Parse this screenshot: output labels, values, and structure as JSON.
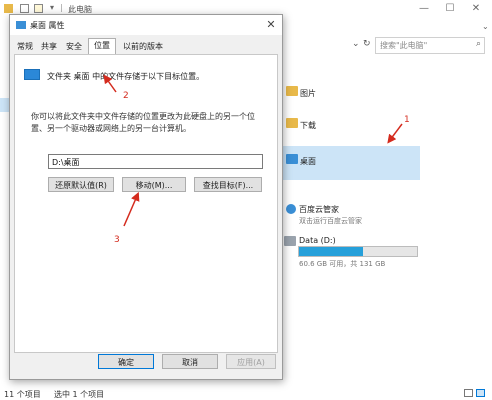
{
  "explorer": {
    "title": "此电脑",
    "search_placeholder": "搜索\"此电脑\"",
    "window_controls": {
      "minimize": "—",
      "maximize": "☐",
      "close": "✕"
    },
    "folders": [
      {
        "label": "图片"
      },
      {
        "label": "下载"
      },
      {
        "label": "桌面",
        "selected": true
      }
    ],
    "drives": {
      "app_title": "百度云管家",
      "app_subtitle": "双击运行百度云管家",
      "drive_name": "Data (D:)",
      "drive_usage_text": "60.6 GB 可用，共 131 GB",
      "used_fraction": 0.54
    },
    "status": {
      "items_count": "11 个项目",
      "selected_count": "选中 1 个项目"
    }
  },
  "dialog": {
    "title": "桌面 属性",
    "close_label": "✕",
    "tabs": [
      "常规",
      "共享",
      "安全",
      "位置",
      "以前的版本"
    ],
    "active_tab": "位置",
    "desc1": "文件夹 桌面 中的文件存储于以下目标位置。",
    "desc2_line1": "你可以将此文件夹中文件存储的位置更改为此硬盘上的另一个位",
    "desc2_line2": "置、另一个驱动器或网络上的另一台计算机。",
    "path_value": "D:\\桌面",
    "btn_restore": "还原默认值(R)",
    "btn_move": "移动(M)...",
    "btn_find_target": "查找目标(F)...",
    "btn_ok": "确定",
    "btn_cancel": "取消",
    "btn_apply": "应用(A)"
  },
  "annotations": {
    "n1": "1",
    "n2": "2",
    "n3": "3",
    "color": "#d42b1e"
  }
}
